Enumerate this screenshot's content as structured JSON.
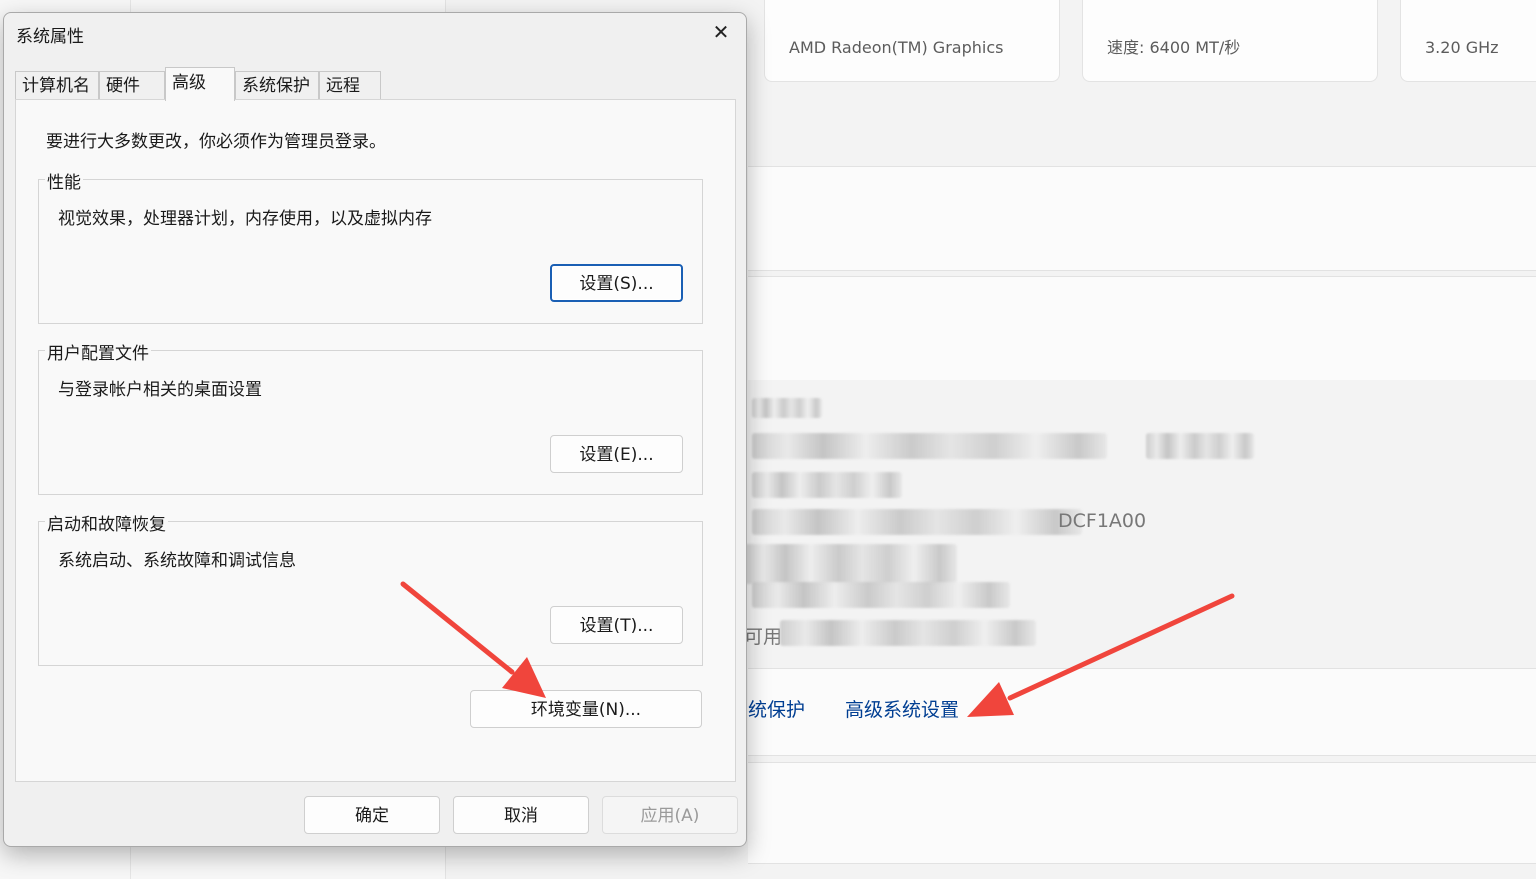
{
  "background": {
    "spec_cards": [
      {
        "value": "AMD Radeon(TM) Graphics"
      },
      {
        "value": "速度: 6400 MT/秒"
      },
      {
        "value": "3.20 GHz"
      }
    ],
    "partial_text": {
      "value_suffix": "DCF1A00",
      "row_label": "可用"
    },
    "related_links": [
      {
        "label": "统保护"
      },
      {
        "label": "高级系统设置"
      }
    ]
  },
  "dialog": {
    "title": "系统属性",
    "close_label": "✕",
    "tabs": [
      {
        "label": "计算机名"
      },
      {
        "label": "硬件"
      },
      {
        "label": "高级",
        "active": true
      },
      {
        "label": "系统保护"
      },
      {
        "label": "远程"
      }
    ],
    "admin_note": "要进行大多数更改，你必须作为管理员登录。",
    "groups": {
      "performance": {
        "title": "性能",
        "description": "视觉效果，处理器计划，内存使用，以及虚拟内存",
        "button": "设置(S)..."
      },
      "user_profiles": {
        "title": "用户配置文件",
        "description": "与登录帐户相关的桌面设置",
        "button": "设置(E)..."
      },
      "startup_recovery": {
        "title": "启动和故障恢复",
        "description": "系统启动、系统故障和调试信息",
        "button": "设置(T)..."
      }
    },
    "env_button": "环境变量(N)...",
    "footer": {
      "ok": "确定",
      "cancel": "取消",
      "apply": "应用(A)"
    }
  },
  "annotation": {
    "arrow_color": "#f0453c"
  }
}
